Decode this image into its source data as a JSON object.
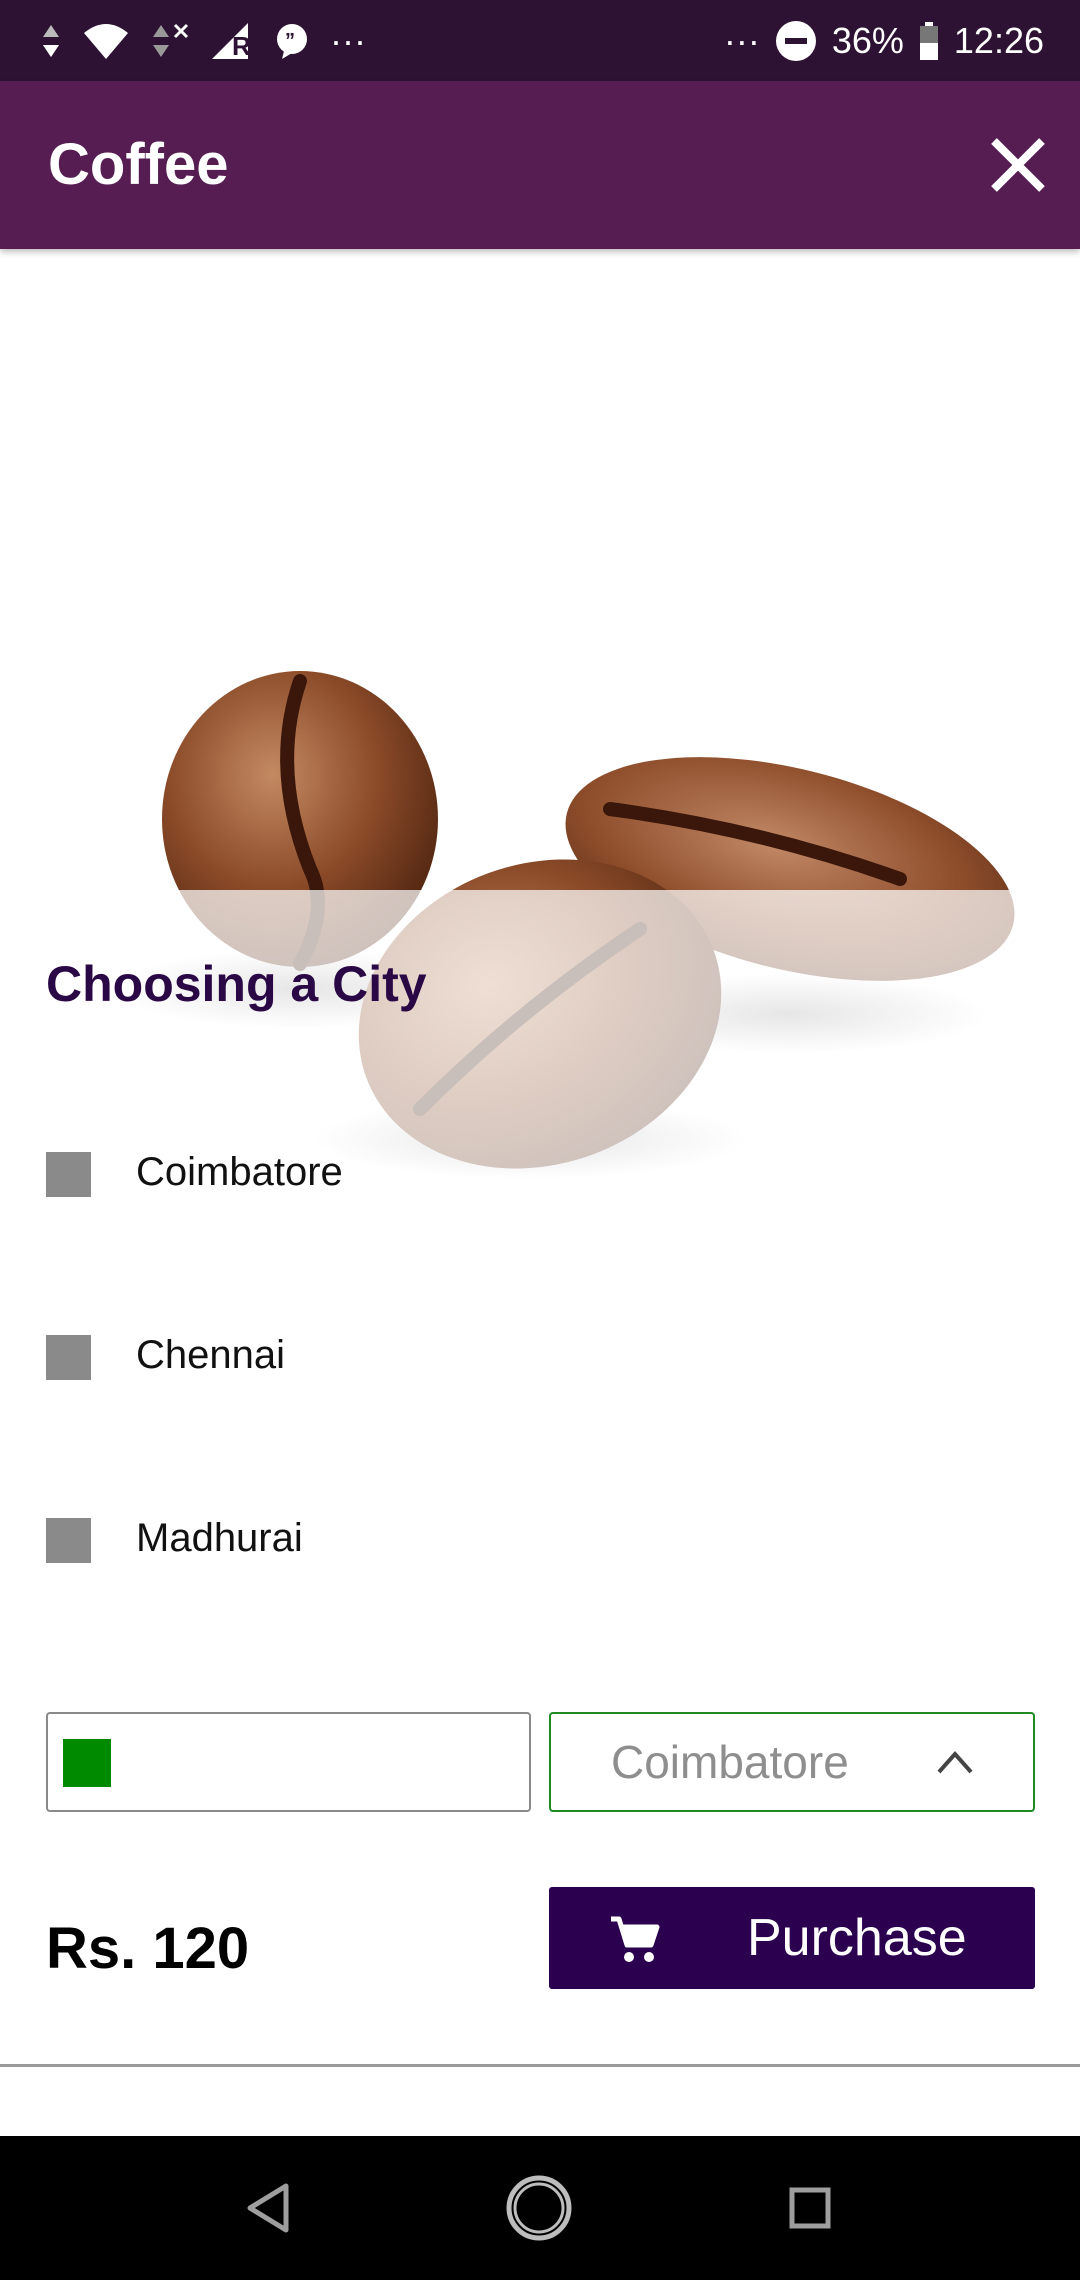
{
  "status_bar": {
    "battery": "36%",
    "time": "12:26",
    "left_more": "···",
    "right_more": "···",
    "icons": [
      "data-arrows-icon",
      "wifi-icon",
      "data-arrows-x-icon",
      "signal-roaming-icon",
      "chat-bubble-icon",
      "do-not-disturb-icon",
      "battery-icon"
    ]
  },
  "app_bar": {
    "title": "Coffee",
    "close_icon": "close-icon"
  },
  "hero": {
    "image": "coffee-beans-image"
  },
  "section": {
    "title": "Choosing a City"
  },
  "cities": [
    {
      "label": "Coimbatore"
    },
    {
      "label": "Chennai"
    },
    {
      "label": "Madhurai"
    }
  ],
  "controls": {
    "color_swatch": "#008a00",
    "selected_city": "Coimbatore",
    "chevron_icon": "chevron-up-icon"
  },
  "purchase": {
    "price": "Rs. 120",
    "button_label": "Purchase",
    "icon": "cart-icon"
  },
  "nav_bar": {
    "icons": [
      "back-icon",
      "home-icon",
      "recents-icon"
    ]
  },
  "colors": {
    "status_bar": "#2d1233",
    "app_bar": "#561d53",
    "title_text": "#2a0845",
    "purchase_button": "#2a004f",
    "select_border": "#1f8a1f"
  }
}
